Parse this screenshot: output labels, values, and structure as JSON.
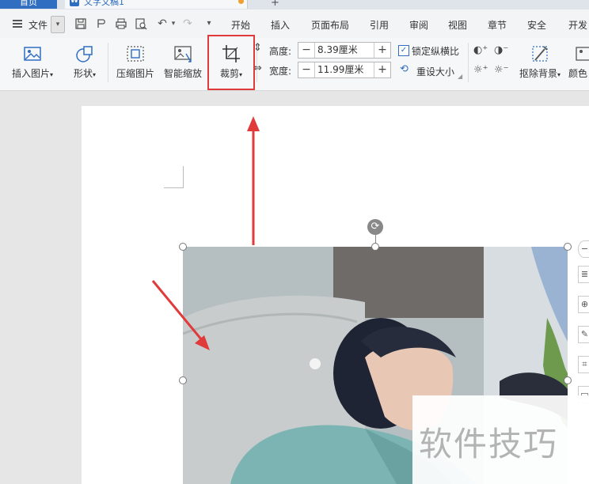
{
  "tabs": {
    "home": "首页",
    "doc": "文字文稿1"
  },
  "menubar": {
    "file": "文件",
    "items": [
      "开始",
      "插入",
      "页面布局",
      "引用",
      "审阅",
      "视图",
      "章节",
      "安全",
      "开发"
    ]
  },
  "ribbon": {
    "insert_picture": "插入图片",
    "shape": "形状",
    "compress": "压缩图片",
    "smart_zoom": "智能缩放",
    "crop": "裁剪",
    "height_label": "高度:",
    "height_value": "8.39厘米",
    "width_label": "宽度:",
    "width_value": "11.99厘米",
    "lock_ratio": "锁定纵横比",
    "reset_size": "重设大小",
    "remove_bg": "抠除背景",
    "color": "颜色"
  },
  "watermark": "软件技巧",
  "colors": {
    "accent": "#2f6ec1",
    "highlight": "#e03a3a"
  }
}
